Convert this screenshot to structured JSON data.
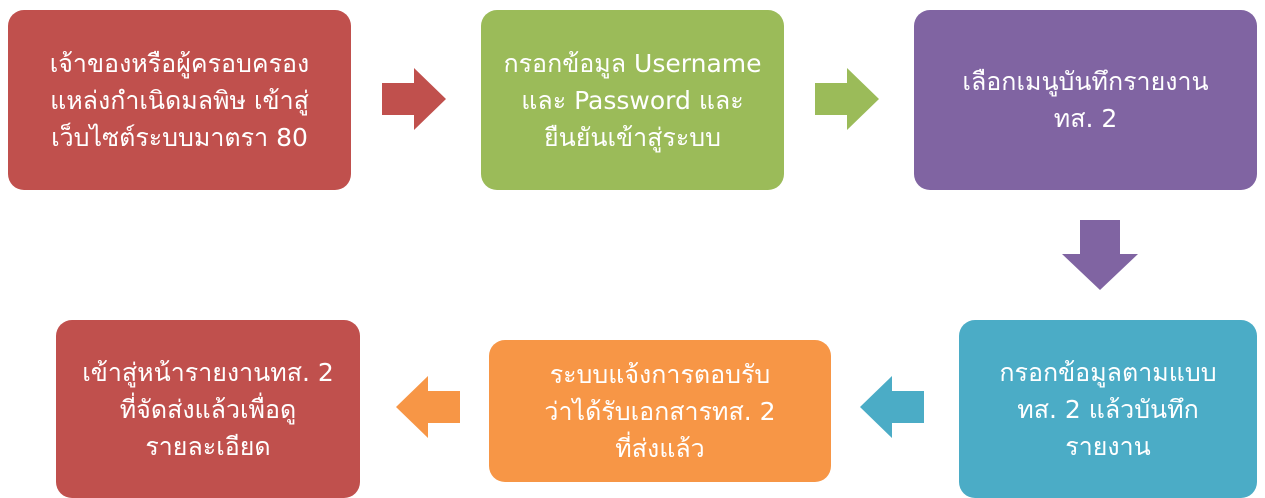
{
  "steps": [
    {
      "id": "step1",
      "lines": [
        "เจ้าของหรือผู้ครอบครอง",
        "แหล่งกำเนิดมลพิษ  เข้าสู่",
        "เว็บไซต์ระบบมาตรา 80"
      ],
      "color": "#c0504d"
    },
    {
      "id": "step2",
      "lines": [
        "กรอกข้อมูล Username",
        "และ Password และ",
        "ยืนยันเข้าสู่ระบบ"
      ],
      "color": "#9bbb59"
    },
    {
      "id": "step3",
      "lines": [
        "เลือกเมนูบันทึกรายงาน",
        "ทส. 2"
      ],
      "color": "#8064a2"
    },
    {
      "id": "step4",
      "lines": [
        "กรอกข้อมูลตามแบบ",
        "ทส. 2 แล้วบันทึก",
        "รายงาน"
      ],
      "color": "#4bacc6"
    },
    {
      "id": "step5",
      "lines": [
        "ระบบแจ้งการตอบรับ",
        "ว่าได้รับเอกสารทส. 2",
        "ที่ส่งแล้ว"
      ],
      "color": "#f79646"
    },
    {
      "id": "step6",
      "lines": [
        "เข้าสู่หน้ารายงานทส. 2",
        "ที่จัดส่งแล้วเพื่อดู",
        "รายละเอียด"
      ],
      "color": "#c0504d"
    }
  ],
  "arrows": [
    {
      "from": "step1",
      "to": "step2",
      "direction": "right",
      "color": "#c0504d"
    },
    {
      "from": "step2",
      "to": "step3",
      "direction": "right",
      "color": "#9bbb59"
    },
    {
      "from": "step3",
      "to": "step4",
      "direction": "down",
      "color": "#8064a2"
    },
    {
      "from": "step4",
      "to": "step5",
      "direction": "left",
      "color": "#4bacc6"
    },
    {
      "from": "step5",
      "to": "step6",
      "direction": "left",
      "color": "#f79646"
    }
  ]
}
